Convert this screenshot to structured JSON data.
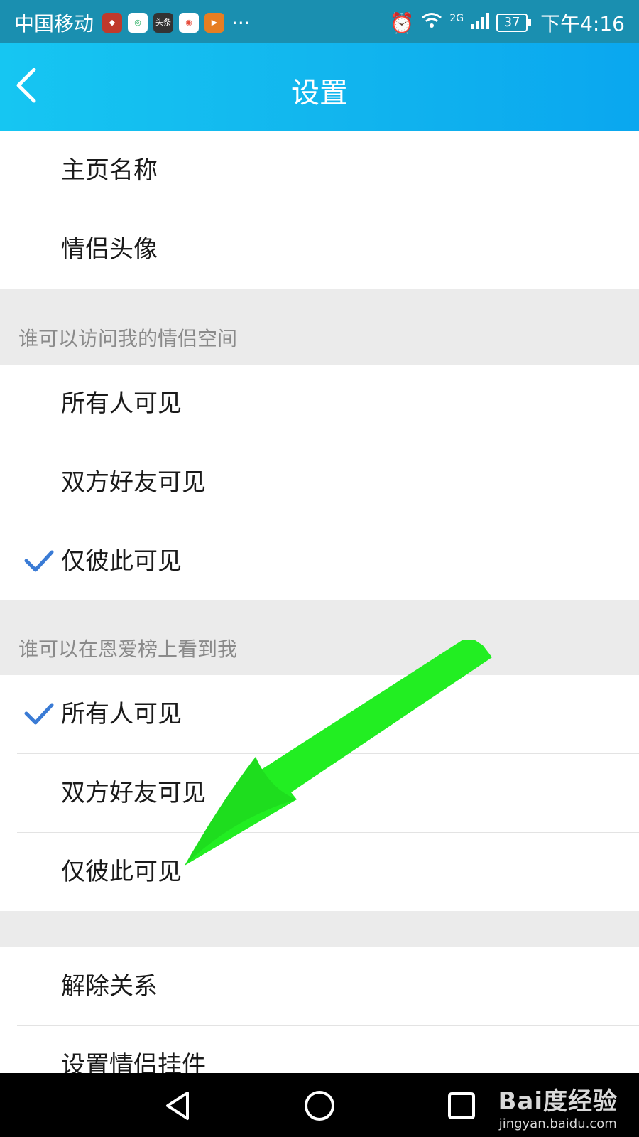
{
  "status_bar": {
    "carrier": "中国移动",
    "more": "···",
    "network": "2G",
    "battery": "37",
    "time": "下午4:16"
  },
  "header": {
    "title": "设置"
  },
  "group_profile": {
    "items": [
      {
        "label": "主页名称"
      },
      {
        "label": "情侣头像"
      }
    ]
  },
  "section_visit": {
    "header": "谁可以访问我的情侣空间",
    "items": [
      {
        "label": "所有人可见",
        "checked": false
      },
      {
        "label": "双方好友可见",
        "checked": false
      },
      {
        "label": "仅彼此可见",
        "checked": true
      }
    ]
  },
  "section_rank": {
    "header": "谁可以在恩爱榜上看到我",
    "items": [
      {
        "label": "所有人可见",
        "checked": true
      },
      {
        "label": "双方好友可见",
        "checked": false
      },
      {
        "label": "仅彼此可见",
        "checked": false
      }
    ]
  },
  "group_relation": {
    "items": [
      {
        "label": "解除关系"
      },
      {
        "label": "设置情侣挂件"
      }
    ]
  },
  "watermark": {
    "main": "Bai度经验",
    "sub": "jingyan.baidu.com"
  },
  "colors": {
    "header": "#12b6ee",
    "check": "#3a7bd5",
    "arrow": "#22ee22",
    "background": "#ebebeb"
  }
}
